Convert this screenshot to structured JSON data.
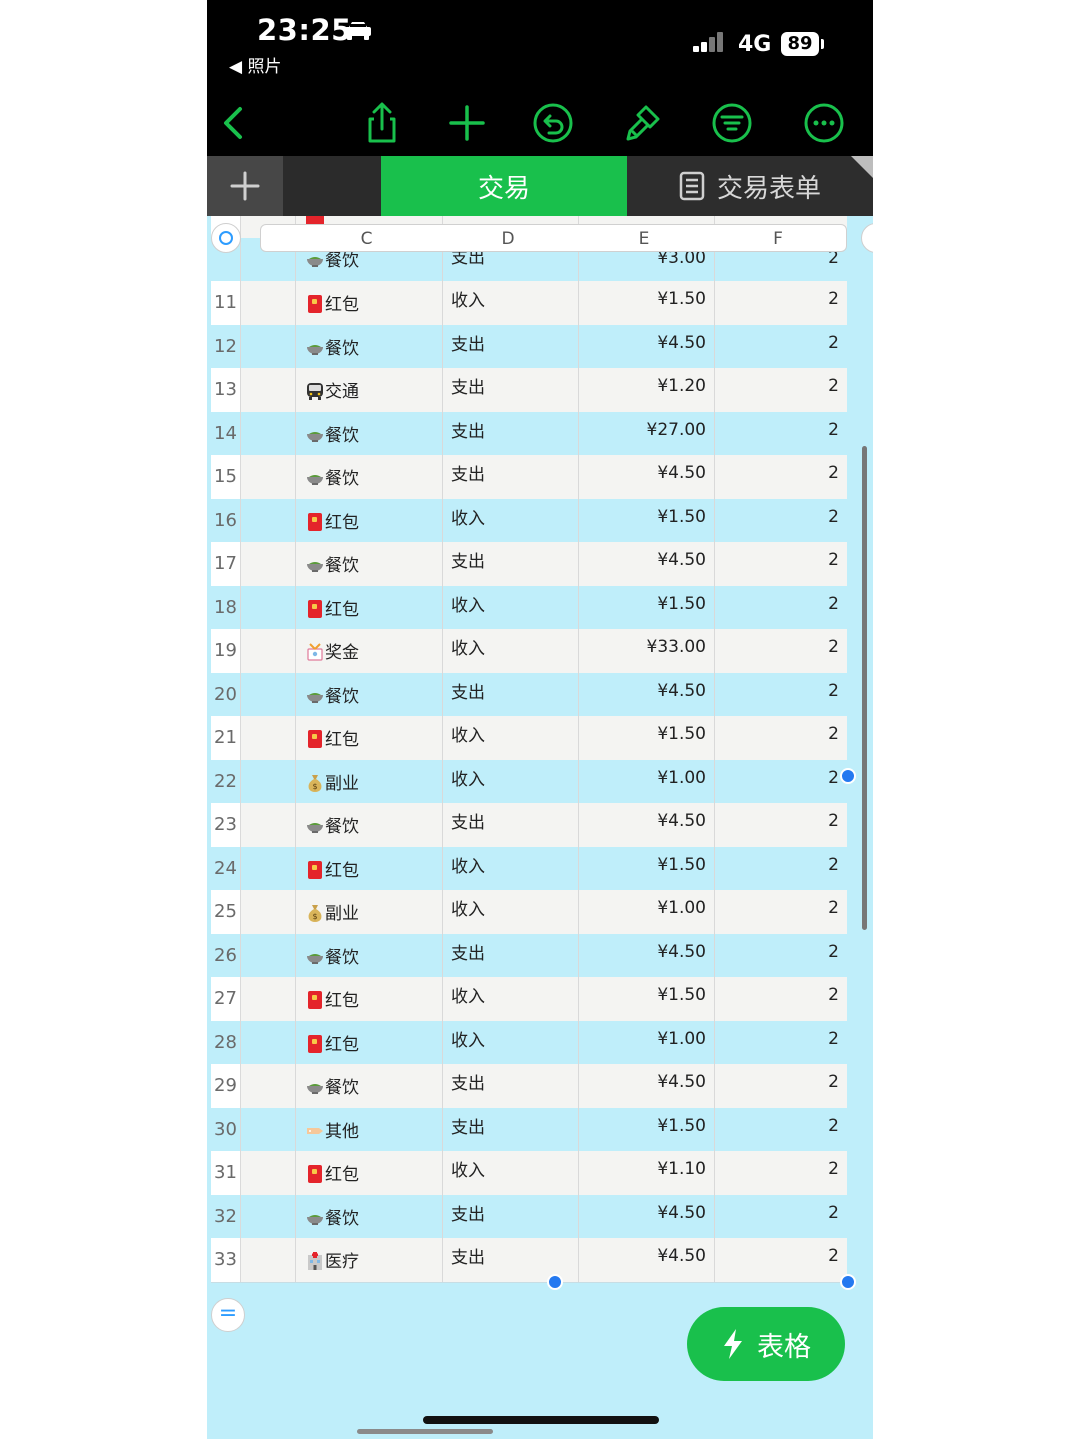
{
  "status": {
    "time": "23:25",
    "back_app": "◀ 照片",
    "network": "4G",
    "battery": "89"
  },
  "toolbar": {
    "icons": [
      "back-icon",
      "share-icon",
      "add-icon",
      "undo-icon",
      "brush-icon",
      "filter-icon",
      "more-icon"
    ]
  },
  "tabs": {
    "active": "交易",
    "second": "交易表单"
  },
  "columns": [
    "C",
    "D",
    "E",
    "F"
  ],
  "partial_top_row": {
    "category": "餐饮",
    "type": "支出",
    "amount": "¥3.00",
    "count": "2"
  },
  "rows": [
    {
      "num": "11",
      "icon": "red-envelope-icon",
      "category": "红包",
      "type": "收入",
      "amount": "¥1.50",
      "count": "2"
    },
    {
      "num": "12",
      "icon": "bowl-icon",
      "category": "餐饮",
      "type": "支出",
      "amount": "¥4.50",
      "count": "2"
    },
    {
      "num": "13",
      "icon": "bus-icon",
      "category": "交通",
      "type": "支出",
      "amount": "¥1.20",
      "count": "2"
    },
    {
      "num": "14",
      "icon": "bowl-icon",
      "category": "餐饮",
      "type": "支出",
      "amount": "¥27.00",
      "count": "2"
    },
    {
      "num": "15",
      "icon": "bowl-icon",
      "category": "餐饮",
      "type": "支出",
      "amount": "¥4.50",
      "count": "2"
    },
    {
      "num": "16",
      "icon": "red-envelope-icon",
      "category": "红包",
      "type": "收入",
      "amount": "¥1.50",
      "count": "2"
    },
    {
      "num": "17",
      "icon": "bowl-icon",
      "category": "餐饮",
      "type": "支出",
      "amount": "¥4.50",
      "count": "2"
    },
    {
      "num": "18",
      "icon": "red-envelope-icon",
      "category": "红包",
      "type": "收入",
      "amount": "¥1.50",
      "count": "2"
    },
    {
      "num": "19",
      "icon": "gift-icon",
      "category": "奖金",
      "type": "收入",
      "amount": "¥33.00",
      "count": "2"
    },
    {
      "num": "20",
      "icon": "bowl-icon",
      "category": "餐饮",
      "type": "支出",
      "amount": "¥4.50",
      "count": "2"
    },
    {
      "num": "21",
      "icon": "red-envelope-icon",
      "category": "红包",
      "type": "收入",
      "amount": "¥1.50",
      "count": "2"
    },
    {
      "num": "22",
      "icon": "money-bag-icon",
      "category": "副业",
      "type": "收入",
      "amount": "¥1.00",
      "count": "2"
    },
    {
      "num": "23",
      "icon": "bowl-icon",
      "category": "餐饮",
      "type": "支出",
      "amount": "¥4.50",
      "count": "2"
    },
    {
      "num": "24",
      "icon": "red-envelope-icon",
      "category": "红包",
      "type": "收入",
      "amount": "¥1.50",
      "count": "2"
    },
    {
      "num": "25",
      "icon": "money-bag-icon",
      "category": "副业",
      "type": "收入",
      "amount": "¥1.00",
      "count": "2"
    },
    {
      "num": "26",
      "icon": "bowl-icon",
      "category": "餐饮",
      "type": "支出",
      "amount": "¥4.50",
      "count": "2"
    },
    {
      "num": "27",
      "icon": "red-envelope-icon",
      "category": "红包",
      "type": "收入",
      "amount": "¥1.50",
      "count": "2"
    },
    {
      "num": "28",
      "icon": "red-envelope-icon",
      "category": "红包",
      "type": "收入",
      "amount": "¥1.00",
      "count": "2"
    },
    {
      "num": "29",
      "icon": "bowl-icon",
      "category": "餐饮",
      "type": "支出",
      "amount": "¥4.50",
      "count": "2"
    },
    {
      "num": "30",
      "icon": "tag-icon",
      "category": "其他",
      "type": "支出",
      "amount": "¥1.50",
      "count": "2"
    },
    {
      "num": "31",
      "icon": "red-envelope-icon",
      "category": "红包",
      "type": "收入",
      "amount": "¥1.10",
      "count": "2"
    },
    {
      "num": "32",
      "icon": "bowl-icon",
      "category": "餐饮",
      "type": "支出",
      "amount": "¥4.50",
      "count": "2"
    },
    {
      "num": "33",
      "icon": "hospital-icon",
      "category": "医疗",
      "type": "支出",
      "amount": "¥4.50",
      "count": "2"
    }
  ],
  "add_row_label": "=",
  "table_button": {
    "label": "表格",
    "icon": "bolt-icon"
  },
  "colors": {
    "accent": "#19c04c",
    "row_alt": "#bfeefa",
    "row_plain": "#f4f4f2",
    "selection": "#2479f0"
  }
}
